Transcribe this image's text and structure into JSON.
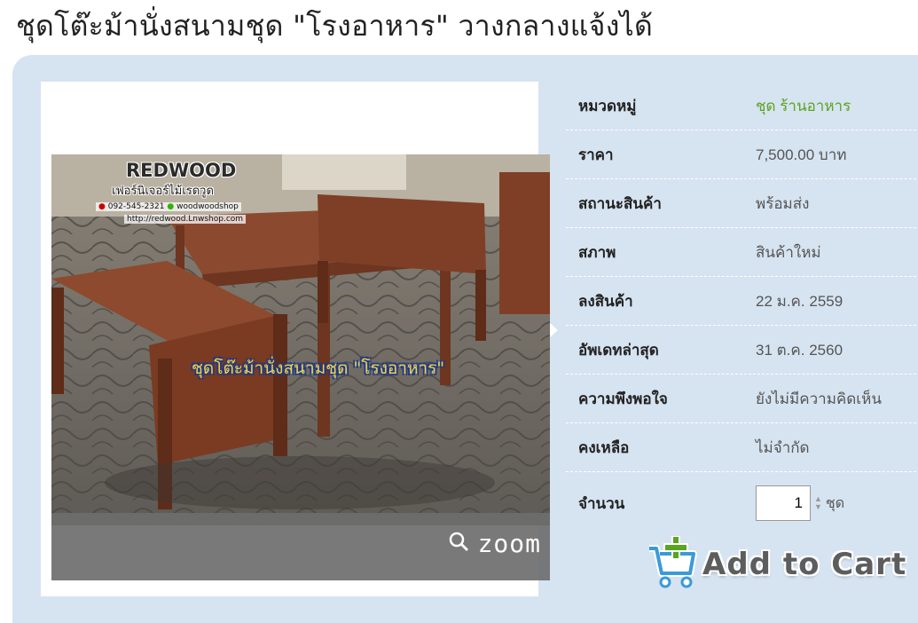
{
  "page": {
    "title": "ชุดโต๊ะม้านั่งสนามชุด \"โรงอาหาร\" วางกลางแจ้งได้"
  },
  "photo": {
    "brand": "REDWOOD",
    "brand_sub": "เฟอร์นิเจอร์ไม้เรดวูด",
    "phone": "092-545-2321",
    "line_id": "woodwoodshop",
    "shop_url": "http://redwood.Lnwshop.com",
    "caption": "ชุดโต๊ะม้านั่งสนามชุด \"โรงอาหาร\"",
    "zoom_label": "zoom"
  },
  "details": {
    "rows": [
      {
        "label": "หมวดหมู่",
        "value": "ชุด ร้านอาหาร"
      },
      {
        "label": "ราคา",
        "value": "7,500.00 บาท"
      },
      {
        "label": "สถานะสินค้า",
        "value": "พร้อมส่ง"
      },
      {
        "label": "สภาพ",
        "value": "สินค้าใหม่"
      },
      {
        "label": "ลงสินค้า",
        "value": "22 ม.ค. 2559"
      },
      {
        "label": "อัพเดทล่าสุด",
        "value": "31 ต.ค. 2560"
      },
      {
        "label": "ความพึงพอใจ",
        "value": "ยังไม่มีความคิดเห็น"
      },
      {
        "label": "คงเหลือ",
        "value": "ไม่จำกัด"
      }
    ],
    "quantity": {
      "label": "จำนวน",
      "value": "1",
      "unit": "ชุด"
    }
  },
  "cart": {
    "label": "Add to Cart",
    "icon": "cart-plus-icon"
  },
  "colors": {
    "panel": "#d6e3f1",
    "category": "#5aa51e",
    "title": "#222222"
  }
}
